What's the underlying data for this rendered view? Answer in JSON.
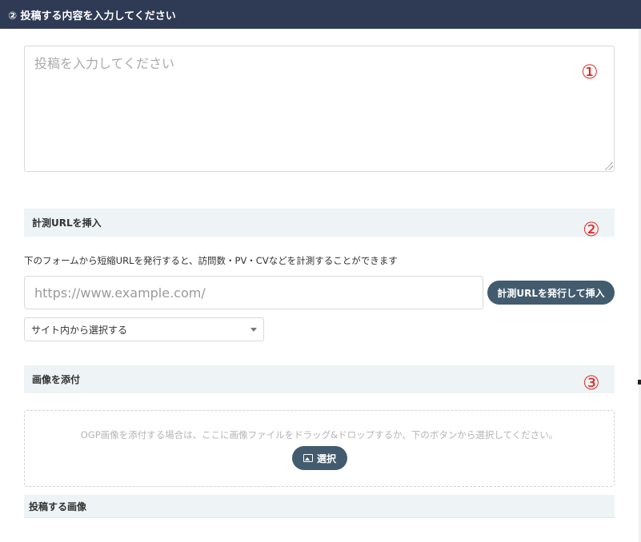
{
  "header": {
    "title": "② 投稿する内容を入力してください"
  },
  "post": {
    "placeholder": "投稿を入力してください",
    "value": ""
  },
  "markers": {
    "one": "①",
    "two": "②",
    "three": "③"
  },
  "tracking_url": {
    "section_title": "計測URLを挿入",
    "description": "下のフォームから短縮URLを発行すると、訪問数・PV・CVなどを計測することができます",
    "input_placeholder": "https://www.example.com/",
    "issue_button_label": "計測URLを発行して挿入",
    "site_select_value": "サイト内から選択する"
  },
  "attach_image": {
    "section_title": "画像を添付",
    "drop_text": "OGP画像を添付する場合は、ここに画像ファイルをドラッグ&ドロップするか、下のボタンから選択してください。",
    "select_button_label": "選択",
    "posted_images_title": "投稿する画像"
  },
  "colors": {
    "header_bg": "#2f3a54",
    "section_bg": "#eef3f5",
    "button_bg": "#435b6e",
    "marker": "#e32424"
  }
}
